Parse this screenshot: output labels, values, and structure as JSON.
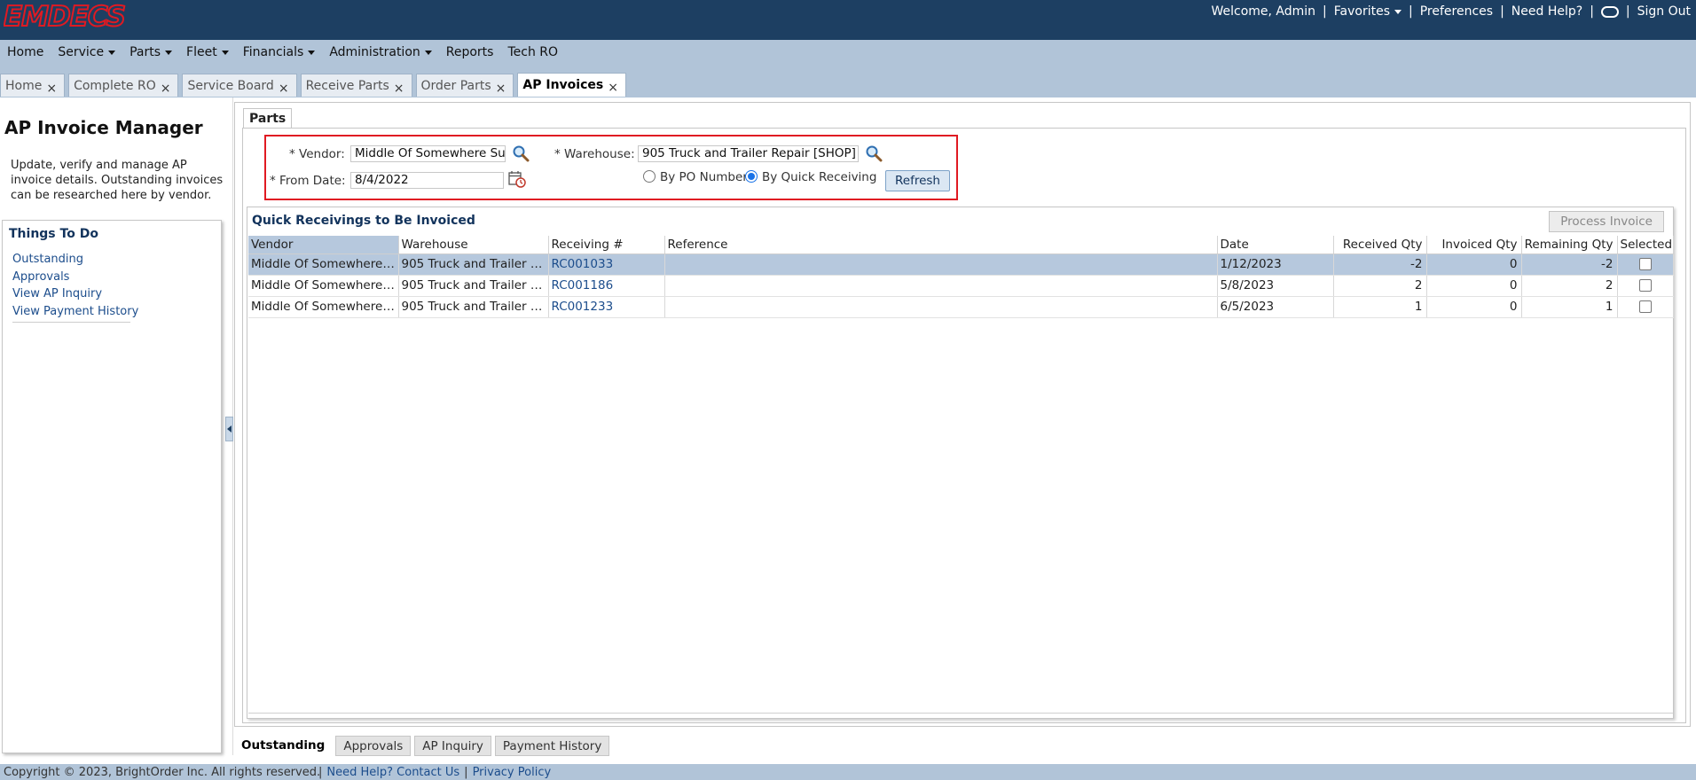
{
  "app": {
    "logo_text": "EMDECS",
    "welcome": "Welcome, Admin",
    "top_links": {
      "favorites": "Favorites",
      "preferences": "Preferences",
      "need_help": "Need Help?",
      "sign_out": "Sign Out"
    },
    "separator": "|"
  },
  "menu": {
    "home": "Home",
    "service": "Service",
    "parts": "Parts",
    "fleet": "Fleet",
    "financials": "Financials",
    "administration": "Administration",
    "reports": "Reports",
    "tech_ro": "Tech RO"
  },
  "tabs": [
    {
      "label": "Home"
    },
    {
      "label": "Complete RO"
    },
    {
      "label": "Service Board"
    },
    {
      "label": "Receive Parts"
    },
    {
      "label": "Order Parts"
    },
    {
      "label": "AP Invoices"
    }
  ],
  "close_glyph": "×",
  "left_panel": {
    "title": "AP Invoice Manager",
    "description": "Update, verify and manage AP invoice details. Outstanding invoices can be researched here by vendor.",
    "todo_title": "Things To Do",
    "todo_items": [
      "Outstanding",
      "Approvals",
      "View AP Inquiry",
      "View Payment History"
    ]
  },
  "parts_tab": "Parts",
  "filter": {
    "vendor_label": "* Vendor:",
    "vendor_value": "Middle Of Somewhere Supp",
    "warehouse_label": "* Warehouse:",
    "warehouse_value": "905 Truck and Trailer Repair [SHOP]",
    "from_date_label": "* From Date:",
    "from_date_value": "8/4/2022",
    "radio_po": "By PO Number",
    "radio_qr": "By Quick Receiving",
    "selected_radio": "qr",
    "refresh_label": "Refresh"
  },
  "grid": {
    "title": "Quick Receivings to Be Invoiced",
    "process_label": "Process Invoice",
    "columns": [
      "Vendor",
      "Warehouse",
      "Receiving #",
      "Reference",
      "Date",
      "Received Qty",
      "Invoiced Qty",
      "Remaining Qty",
      "Selected"
    ],
    "rows": [
      {
        "vendor": "Middle Of Somewhere S...",
        "warehouse": "905 Truck and Trailer Re...",
        "receiving": "RC001033",
        "reference": "",
        "date": "1/12/2023",
        "received_qty": "-2",
        "invoiced_qty": "0",
        "remaining_qty": "-2",
        "selected": false
      },
      {
        "vendor": "Middle Of Somewhere S...",
        "warehouse": "905 Truck and Trailer Re...",
        "receiving": "RC001186",
        "reference": "",
        "date": "5/8/2023",
        "received_qty": "2",
        "invoiced_qty": "0",
        "remaining_qty": "2",
        "selected": false
      },
      {
        "vendor": "Middle Of Somewhere S...",
        "warehouse": "905 Truck and Trailer Re...",
        "receiving": "RC001233",
        "reference": "",
        "date": "6/5/2023",
        "received_qty": "1",
        "invoiced_qty": "0",
        "remaining_qty": "1",
        "selected": false
      }
    ]
  },
  "bottom_tabs": [
    "Outstanding",
    "Approvals",
    "AP Inquiry",
    "Payment History"
  ],
  "footer": {
    "copyright": "Copyright © 2023, BrightOrder Inc. All rights reserved.",
    "contact": "Need Help? Contact Us",
    "privacy": "Privacy Policy"
  },
  "colors": {
    "topbar": "#1d3f62",
    "nav": "#b1c4d8",
    "logo": "#e01a22",
    "highlight_border": "#e01a22",
    "selected_row": "#b6c8dd",
    "link": "#1c4d8c"
  }
}
